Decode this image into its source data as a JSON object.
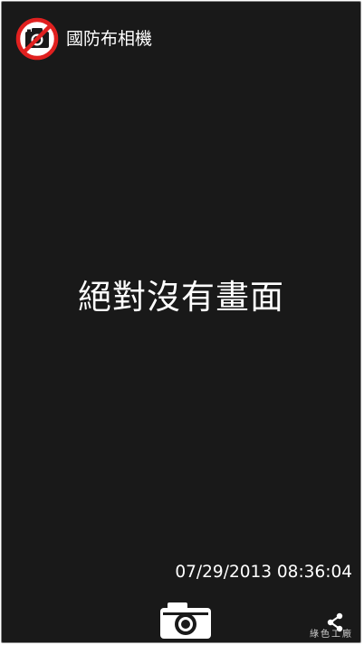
{
  "app_bar": {
    "icon": "no-camera-icon",
    "title": "國防布相機"
  },
  "main": {
    "message": "絕對沒有畫面"
  },
  "footer": {
    "timestamp": "07/29/2013 08:36:04",
    "shutter_icon": "camera-icon",
    "share_icon": "share-icon",
    "watermark": "綠色工廠"
  },
  "colors": {
    "background": "#191919",
    "text": "#ffffff",
    "prohibition_red": "#e0201f"
  }
}
